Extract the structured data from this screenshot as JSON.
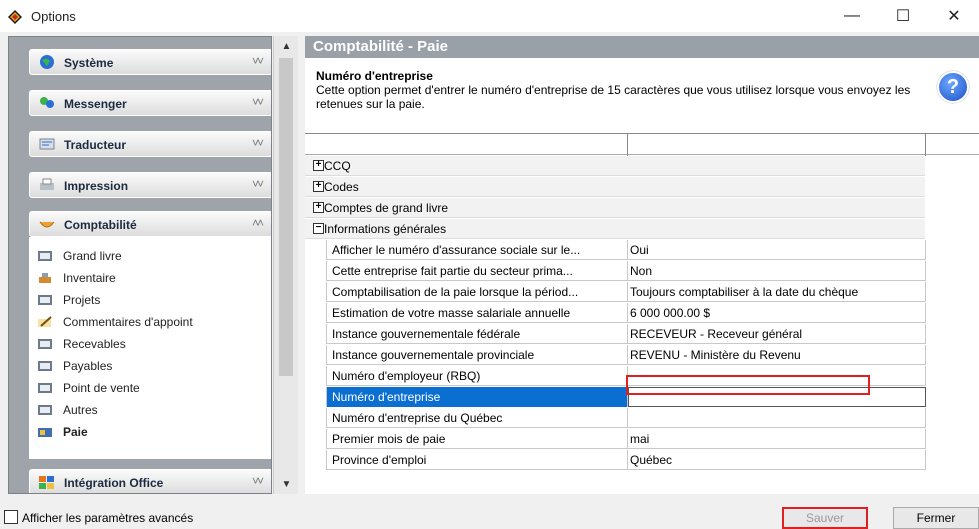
{
  "window": {
    "title": "Options",
    "controls": {
      "minimize": "—",
      "maximize": "☐",
      "close": "✕"
    }
  },
  "sidebar": {
    "groups": [
      {
        "label": "Système",
        "icon": "globe-icon",
        "expanded": false
      },
      {
        "label": "Messenger",
        "icon": "messenger-icon",
        "expanded": false
      },
      {
        "label": "Traducteur",
        "icon": "translator-icon",
        "expanded": false
      },
      {
        "label": "Impression",
        "icon": "printer-icon",
        "expanded": false
      },
      {
        "label": "Comptabilité",
        "icon": "accounting-icon",
        "expanded": true
      },
      {
        "label": "Intégration Office",
        "icon": "office-icon",
        "expanded": false
      }
    ],
    "accounting_items": [
      {
        "label": "Grand livre",
        "icon": "book-icon"
      },
      {
        "label": "Inventaire",
        "icon": "inventory-icon"
      },
      {
        "label": "Projets",
        "icon": "book-icon"
      },
      {
        "label": "Commentaires d'appoint",
        "icon": "pencil-icon"
      },
      {
        "label": "Recevables",
        "icon": "book-icon"
      },
      {
        "label": "Payables",
        "icon": "book-icon"
      },
      {
        "label": "Point de vente",
        "icon": "book-icon"
      },
      {
        "label": "Autres",
        "icon": "book-icon"
      },
      {
        "label": "Paie",
        "icon": "payroll-icon",
        "selected": true
      }
    ]
  },
  "main": {
    "section_title": "Comptabilité - Paie",
    "option_title": "Numéro d'entreprise",
    "option_description": "Cette option permet d'entrer le numéro d'entreprise de 15 caractères que vous utilisez lorsque vous envoyez les retenues sur la paie.",
    "tree": [
      {
        "label": "CCQ",
        "expanded": false
      },
      {
        "label": "Codes",
        "expanded": false
      },
      {
        "label": "Comptes de grand livre",
        "expanded": false
      },
      {
        "label": "Informations générales",
        "expanded": true
      }
    ],
    "rows": [
      {
        "key": "Afficher le numéro d'assurance sociale sur le...",
        "value": "Oui"
      },
      {
        "key": "Cette entreprise fait partie du secteur prima...",
        "value": "Non"
      },
      {
        "key": "Comptabilisation de la paie lorsque la périod...",
        "value": "Toujours comptabiliser à la date du chèque"
      },
      {
        "key": "Estimation de votre masse salariale annuelle",
        "value": "6 000 000.00 $"
      },
      {
        "key": "Instance gouvernementale fédérale",
        "value": "RECEVEUR - Receveur général"
      },
      {
        "key": "Instance gouvernementale provinciale",
        "value": "REVENU - Ministère du Revenu"
      },
      {
        "key": "Numéro d'employeur (RBQ)",
        "value": ""
      },
      {
        "key": "Numéro d'entreprise",
        "value": "",
        "selected": true
      },
      {
        "key": "Numéro d'entreprise du Québec",
        "value": ""
      },
      {
        "key": "Premier mois de paie",
        "value": "mai"
      },
      {
        "key": "Province d'emploi",
        "value": "Québec"
      }
    ]
  },
  "footer": {
    "advanced_label": "Afficher les paramètres avancés",
    "save_label": "Sauver",
    "close_label": "Fermer"
  },
  "colors": {
    "selection": "#0b6ed1",
    "highlight": "#e02020",
    "section_header": "#9aa0a8"
  }
}
